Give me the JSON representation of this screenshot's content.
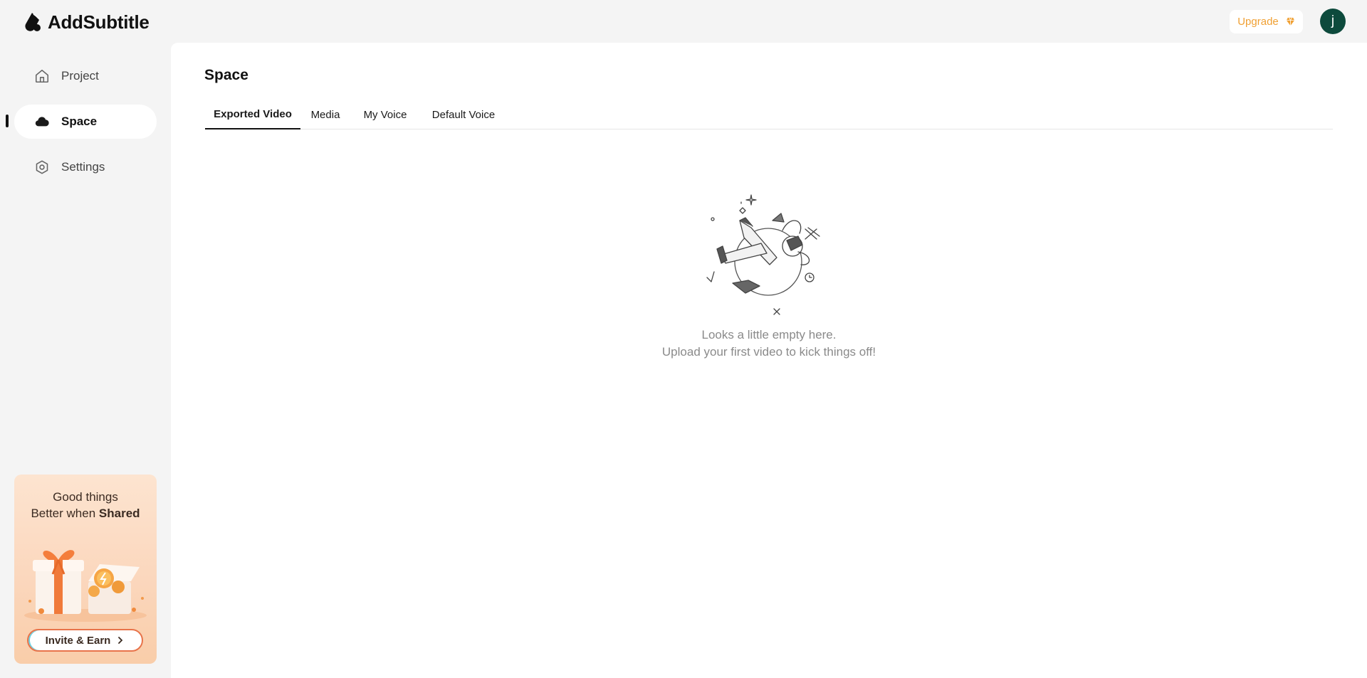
{
  "app": {
    "name": "AddSubtitle"
  },
  "header": {
    "upgrade_label": "Upgrade",
    "avatar_initial": "j",
    "accent_color": "#f0a033",
    "avatar_color": "#0d4a3c"
  },
  "sidebar": {
    "items": [
      {
        "label": "Project",
        "icon": "home-icon"
      },
      {
        "label": "Space",
        "icon": "cloud-icon",
        "active": true
      },
      {
        "label": "Settings",
        "icon": "gear-icon"
      }
    ],
    "promo": {
      "line1": "Good things",
      "line2_prefix": "Better when",
      "line2_bold": "Shared",
      "button_label": "Invite & Earn"
    }
  },
  "main": {
    "title": "Space",
    "tabs": [
      {
        "label": "Exported Video",
        "active": true
      },
      {
        "label": "Media"
      },
      {
        "label": "My Voice"
      },
      {
        "label": "Default Voice"
      }
    ],
    "empty": {
      "line1": "Looks a little empty here.",
      "line2": "Upload your first video to kick things off!"
    }
  }
}
